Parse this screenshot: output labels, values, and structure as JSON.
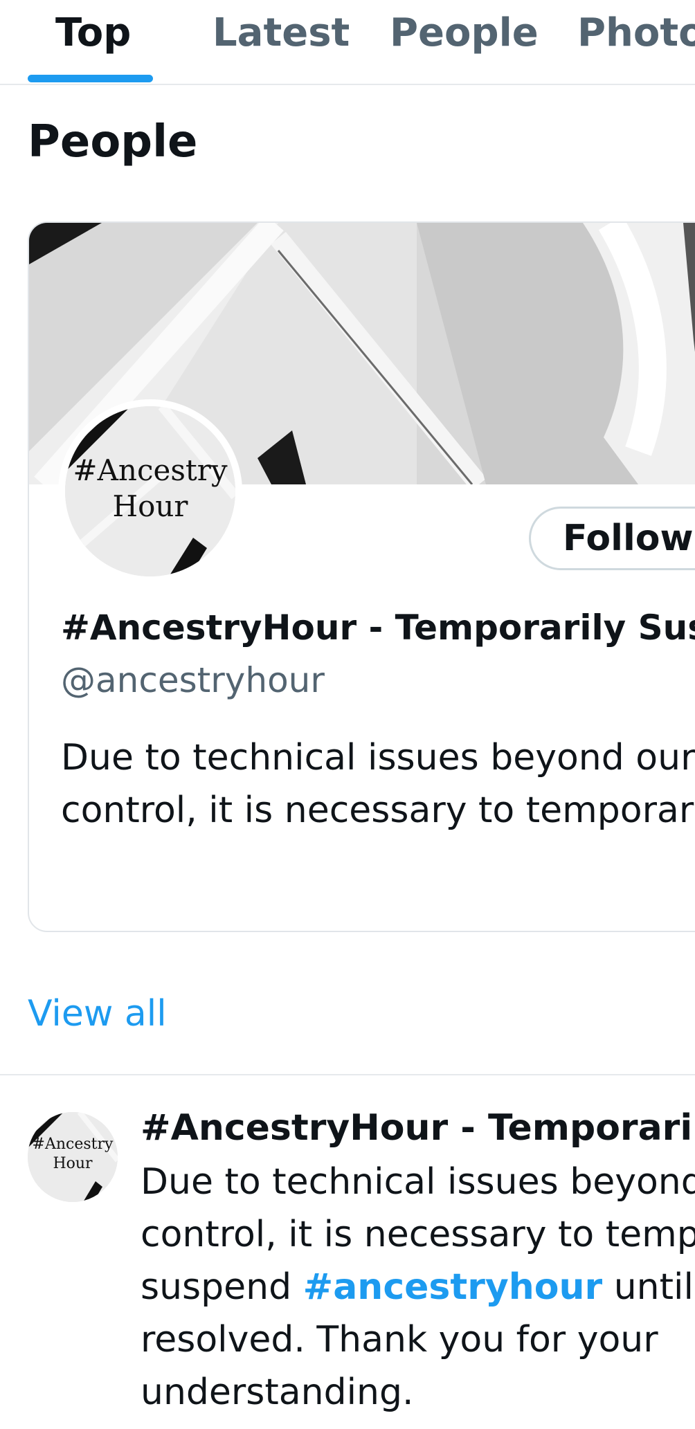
{
  "tabs": [
    {
      "label": "Top",
      "active": true
    },
    {
      "label": "Latest",
      "active": false
    },
    {
      "label": "People",
      "active": false
    },
    {
      "label": "Photos",
      "active": false
    }
  ],
  "section": {
    "title": "People"
  },
  "people_card": {
    "avatar_text_line1": "#Ancestry",
    "avatar_text_line2": "Hour",
    "follow_label": "Following",
    "name": "#AncestryHour - Temporarily Suspended",
    "handle": "@ancestryhour",
    "bio_line1": "Due to technical issues beyond our",
    "bio_line2": "control, it is necessary to temporarily"
  },
  "view_all_label": "View all",
  "tweet": {
    "avatar_text_line1": "#Ancestry",
    "avatar_text_line2": "Hour",
    "name": "#AncestryHour - Temporarily Suspended",
    "line1": "Due to technical issues beyond our",
    "line2": "control, it is necessary to temporarily",
    "line3_before": "suspend ",
    "hashtag": "#ancestryhour",
    "line3_after": " until this is",
    "line4": "resolved.  Thank you for your",
    "line5": "understanding."
  },
  "colors": {
    "accent": "#1d9bf0",
    "text_primary": "#0f1419",
    "text_secondary": "#536471",
    "border": "#e1e5e9"
  }
}
